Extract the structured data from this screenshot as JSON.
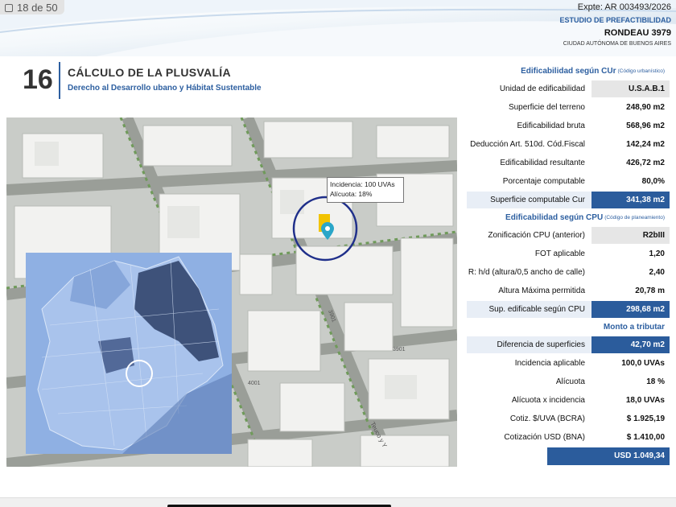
{
  "viewer": {
    "page_indicator": "18 de 50"
  },
  "header": {
    "expediente": "Expte: AR 003493/2026",
    "study": "ESTUDIO DE PREFACTIBILIDAD",
    "address": "RONDEAU 3979",
    "city": "CIUDAD AUTÓNOMA DE BUENOS AIRES"
  },
  "section": {
    "number": "16",
    "title": "CÁLCULO DE LA PLUSVALÍA",
    "subtitle": "Derecho al Desarrollo ubano y Hábitat Sustentable"
  },
  "map": {
    "tooltip_line1": "Incidencia: 100 UVAs",
    "tooltip_line2": "Alícuota: 18%",
    "street_labels": [
      "3901",
      "4001",
      "3901",
      "Teuco y Y"
    ],
    "colors": {
      "highlight_circle": "#1f2f8a",
      "pin": "#2aa6c8",
      "building_marker": "#f2c300"
    }
  },
  "table": {
    "sections": [
      {
        "title": "Edificabilidad según CUr",
        "note": "(Código urbanístico)",
        "rows": [
          {
            "label": "Unidad de edificabilidad",
            "value": "U.S.A.B.1",
            "style": "gray"
          },
          {
            "label": "Superficie del terreno",
            "value": "248,90 m2",
            "style": "plain"
          },
          {
            "label": "Edificabilidad bruta",
            "value": "568,96 m2",
            "style": "plain"
          },
          {
            "label": "Deducción Art. 510d. Cód.Fiscal",
            "value": "142,24 m2",
            "style": "plain"
          },
          {
            "label": "Edificabilidad resultante",
            "value": "426,72 m2",
            "style": "plain"
          },
          {
            "label": "Porcentaje computable",
            "value": "80,0%",
            "style": "plain"
          },
          {
            "label": "Superficie computable Cur",
            "value": "341,38 m2",
            "style": "blue"
          }
        ]
      },
      {
        "title": "Edificabilidad según CPU",
        "note": "(Código de planeamiento)",
        "rows": [
          {
            "label": "Zonificación CPU (anterior)",
            "value": "R2bIII",
            "style": "gray"
          },
          {
            "label": "FOT aplicable",
            "value": "1,20",
            "style": "plain"
          },
          {
            "label": "R: h/d (altura/0,5 ancho de calle)",
            "value": "2,40",
            "style": "plain"
          },
          {
            "label": "Altura Máxima permitida",
            "value": "20,78 m",
            "style": "plain"
          },
          {
            "label": "Sup. edificable según CPU",
            "value": "298,68 m2",
            "style": "blue"
          }
        ]
      },
      {
        "title": "Monto a tributar",
        "note": "",
        "rows": [
          {
            "label": "Diferencia de superficies",
            "value": "42,70 m2",
            "style": "blue"
          },
          {
            "label": "Incidencia aplicable",
            "value": "100,0 UVAs",
            "style": "plain"
          },
          {
            "label": "Alícuota",
            "value": "18 %",
            "style": "plain"
          },
          {
            "label": "Alícuota x incidencia",
            "value": "18,0 UVAs",
            "style": "plain"
          },
          {
            "label": "Cotiz. $/UVA (BCRA)",
            "value": "$ 1.925,19",
            "style": "plain"
          },
          {
            "label": "Cotización USD (BNA)",
            "value": "$ 1.410,00",
            "style": "plain"
          }
        ]
      }
    ],
    "total": "USD  1.049,34"
  },
  "colors": {
    "accent": "#2d5fa0",
    "value_blue": "#2b5c9c",
    "value_gray": "#e6e6e6"
  }
}
